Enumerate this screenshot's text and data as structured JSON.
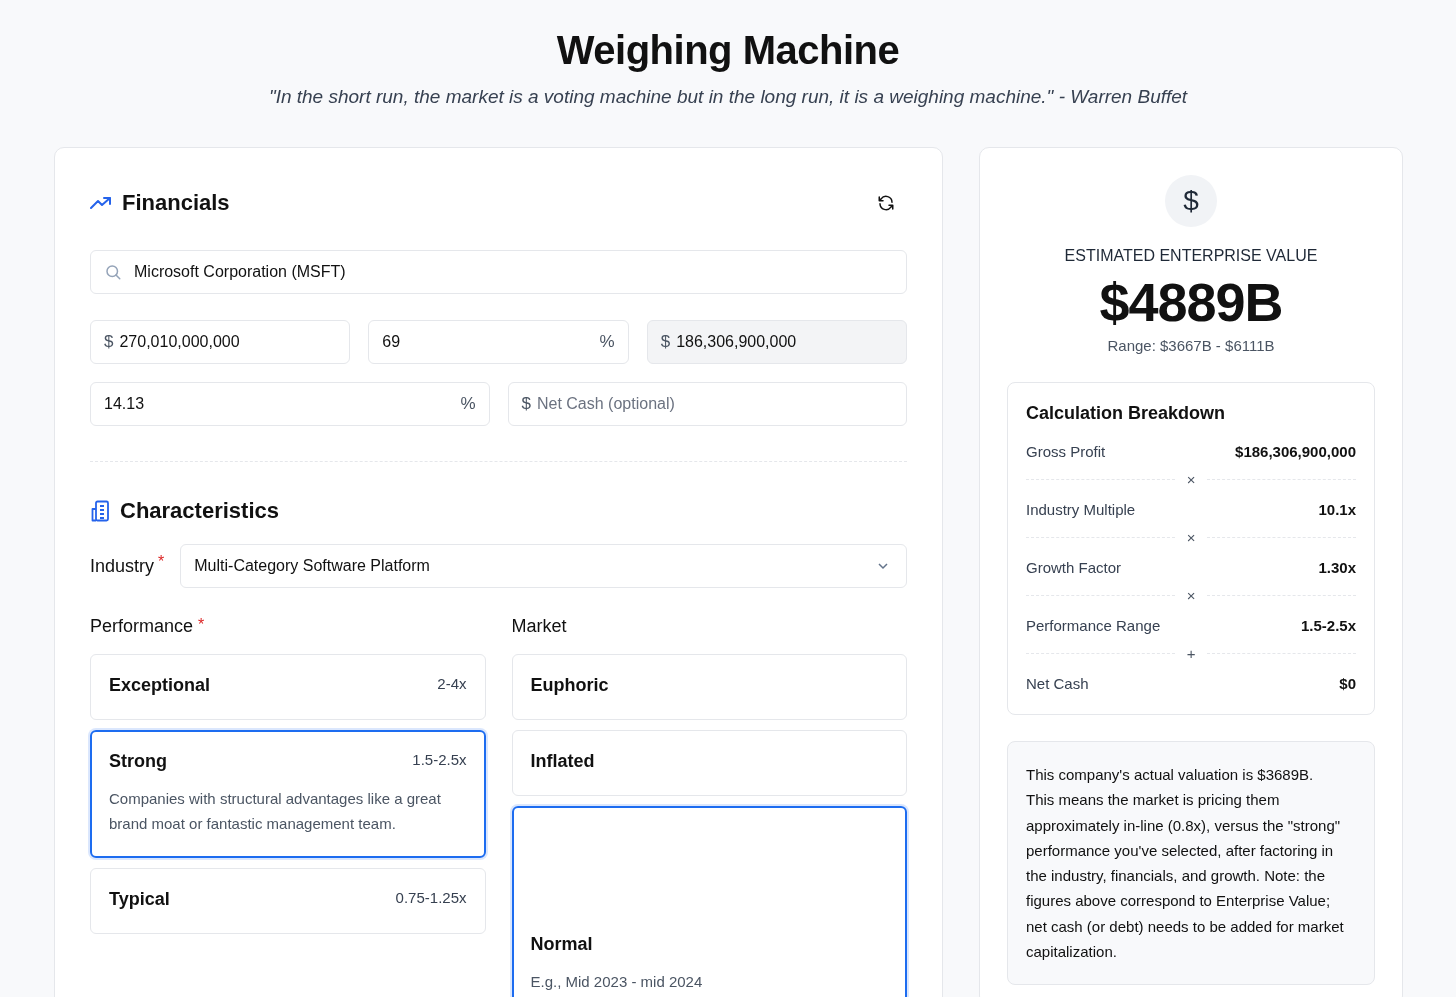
{
  "header": {
    "title": "Weighing Machine",
    "quote": "\"In the short run, the market is a voting machine but in the long run, it is a weighing machine.\" - Warren Buffet"
  },
  "financials": {
    "title": "Financials",
    "search": {
      "value": "Microsoft Corporation (MSFT)"
    },
    "fields": [
      {
        "prefix": "$",
        "value": "270,010,000,000",
        "disabled": false
      },
      {
        "value": "69",
        "suffix": "%",
        "disabled": false
      },
      {
        "prefix": "$",
        "value": "186,306,900,000",
        "disabled": true
      },
      {
        "value": "14.13",
        "suffix": "%",
        "disabled": false
      },
      {
        "prefix": "$",
        "placeholder": "Net Cash (optional)",
        "disabled": false
      }
    ]
  },
  "characteristics": {
    "title": "Characteristics",
    "industry": {
      "label": "Industry",
      "required_mark": "*",
      "value": "Multi-Category Software Platform"
    },
    "performance": {
      "label": "Performance",
      "required_mark": "*",
      "options": [
        {
          "name": "Exceptional",
          "range": "2-4x",
          "selected": false
        },
        {
          "name": "Strong",
          "range": "1.5-2.5x",
          "selected": true,
          "description": "Companies with structural advantages like a great brand moat or fantastic management team."
        },
        {
          "name": "Typical",
          "range": "0.75-1.25x",
          "selected": false
        }
      ]
    },
    "market": {
      "label": "Market",
      "options": [
        {
          "name": "Euphoric",
          "selected": false
        },
        {
          "name": "Inflated",
          "selected": false
        },
        {
          "name": "Normal",
          "selected": true,
          "description": "E.g., Mid 2023 - mid 2024"
        }
      ]
    }
  },
  "result": {
    "icon": "$",
    "label": "ESTIMATED ENTERPRISE VALUE",
    "value": "$4889B",
    "range": "Range: $3667B - $6111B",
    "breakdown": {
      "title": "Calculation Breakdown",
      "rows": [
        {
          "label": "Gross Profit",
          "value": "$186,306,900,000",
          "operator": "×"
        },
        {
          "label": "Industry Multiple",
          "value": "10.1x",
          "operator": "×"
        },
        {
          "label": "Growth Factor",
          "value": "1.30x",
          "operator": "×"
        },
        {
          "label": "Performance Range",
          "value": "1.5-2.5x",
          "operator": "+"
        },
        {
          "label": "Net Cash",
          "value": "$0"
        }
      ]
    },
    "explanation": "This company's actual valuation is $3689B. This means the market is pricing them approximately in-line (0.8x), versus the \"strong\" performance you've selected, after factoring in the industry, financials, and growth. Note: the figures above correspond to Enterprise Value; net cash (or debt) needs to be added for market capitalization."
  }
}
